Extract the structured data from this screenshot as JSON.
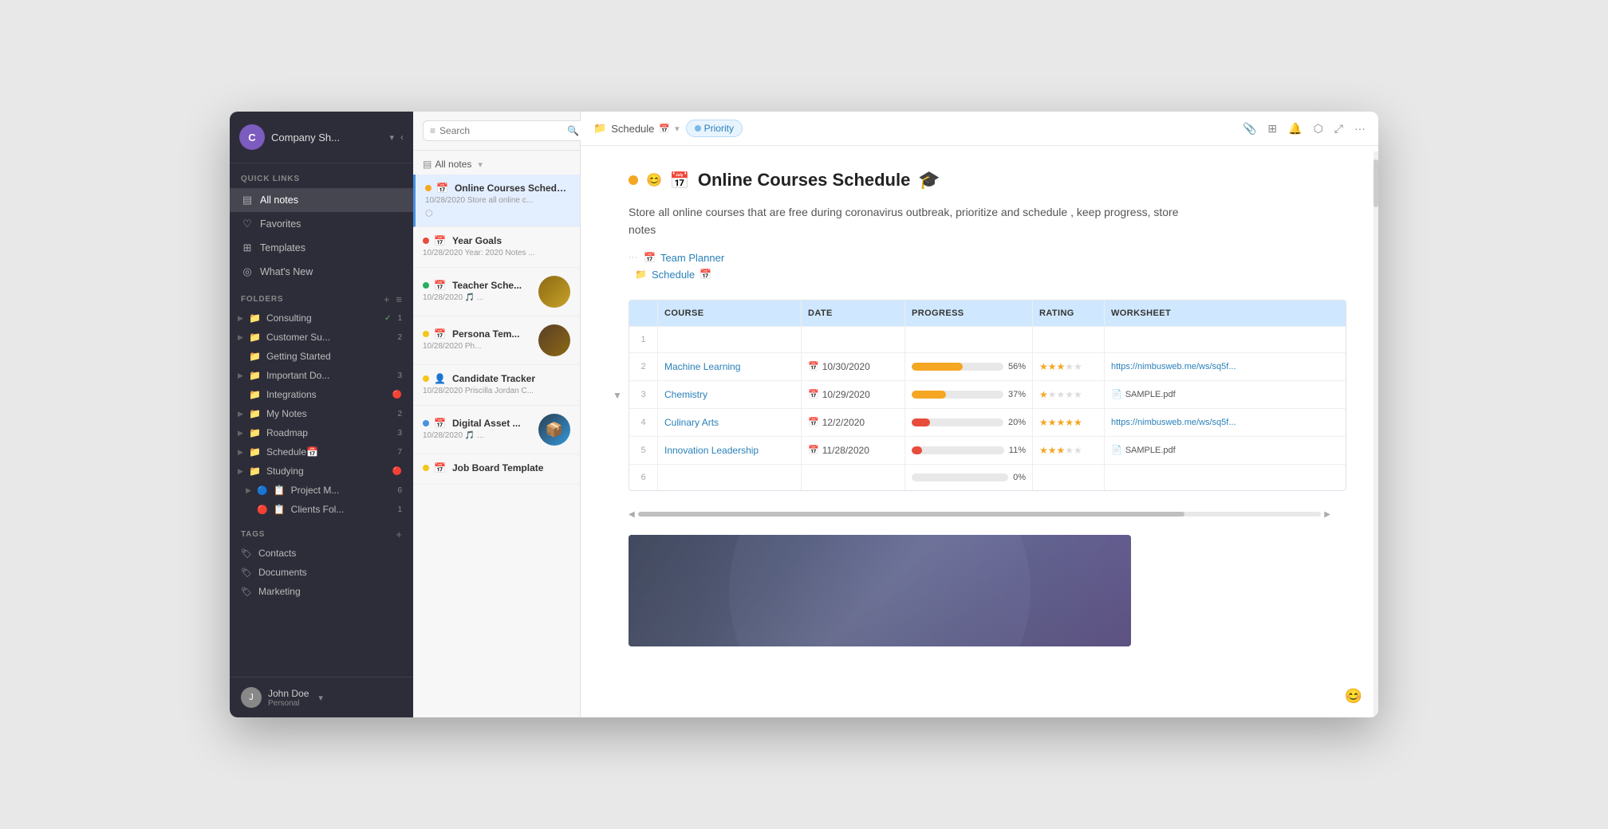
{
  "window": {
    "title": "Company Notes App"
  },
  "sidebar": {
    "company_name": "Company Sh...",
    "avatar_letter": "C",
    "quick_links_label": "Quick Links",
    "items": [
      {
        "id": "all-notes",
        "label": "All notes",
        "icon": "▤",
        "active": true
      },
      {
        "id": "favorites",
        "label": "Favorites",
        "icon": "♡",
        "active": false
      },
      {
        "id": "templates",
        "label": "Templates",
        "icon": "⊞",
        "active": false
      },
      {
        "id": "whats-new",
        "label": "What's New",
        "icon": "◎",
        "active": false
      }
    ],
    "folders_label": "Folders",
    "folders": [
      {
        "name": "Consulting",
        "icon": "📁",
        "has_check": true,
        "badge": "1",
        "expanded": false,
        "indent": 0
      },
      {
        "name": "Customer Su...",
        "icon": "📁",
        "has_check": false,
        "badge": "2",
        "expanded": false,
        "indent": 0
      },
      {
        "name": "Getting Started",
        "icon": "📁",
        "has_check": false,
        "badge": "",
        "expanded": false,
        "indent": 0
      },
      {
        "name": "Important Do...",
        "icon": "📁",
        "has_check": false,
        "badge": "3",
        "expanded": false,
        "indent": 0
      },
      {
        "name": "Integrations",
        "icon": "📁🔴",
        "has_check": false,
        "badge": "",
        "expanded": false,
        "indent": 0
      },
      {
        "name": "My Notes",
        "icon": "📁",
        "has_check": false,
        "badge": "2",
        "expanded": false,
        "indent": 0
      },
      {
        "name": "Roadmap",
        "icon": "📁",
        "has_check": false,
        "badge": "3",
        "expanded": false,
        "indent": 0
      },
      {
        "name": "Schedule",
        "icon": "📁📅",
        "has_check": false,
        "badge": "7",
        "expanded": false,
        "indent": 0
      },
      {
        "name": "Studying",
        "icon": "📁🔴",
        "has_check": false,
        "badge": "",
        "expanded": false,
        "indent": 0
      },
      {
        "name": "Project M...",
        "icon": "🔵📋",
        "has_check": false,
        "badge": "6",
        "expanded": false,
        "indent": 0
      },
      {
        "name": "Clients Fol...",
        "icon": "🔴📋",
        "has_check": false,
        "badge": "1",
        "expanded": false,
        "indent": 0
      }
    ],
    "tags_label": "Tags",
    "tags": [
      {
        "name": "Contacts",
        "icon": "🏷"
      },
      {
        "name": "Documents",
        "icon": "🏷"
      },
      {
        "name": "Marketing",
        "icon": "🏷"
      }
    ],
    "user_name": "John Doe",
    "user_plan": "Personal",
    "user_avatar": "J"
  },
  "notes_panel": {
    "search_placeholder": "Search",
    "all_notes_label": "All notes",
    "notes": [
      {
        "id": 1,
        "title": "Online Courses Schedu...",
        "date": "10/28/2020",
        "preview": "Store all online c...",
        "dot_color": "orange",
        "selected": true,
        "has_avatar": false,
        "has_share": true,
        "icon": "📅"
      },
      {
        "id": 2,
        "title": "Year Goals",
        "date": "10/28/2020",
        "preview": "Year: 2020 Notes ...",
        "dot_color": "red",
        "selected": false,
        "has_avatar": false,
        "icon": "📅"
      },
      {
        "id": 3,
        "title": "Teacher Sche...",
        "date": "10/28/2020",
        "preview": "🎵 ...",
        "dot_color": "green",
        "selected": false,
        "has_avatar": true,
        "avatar_color": "#8B6914",
        "icon": "📅"
      },
      {
        "id": 4,
        "title": "Persona Tem...",
        "date": "10/28/2020",
        "preview": "Ph...",
        "dot_color": "yellow",
        "selected": false,
        "has_avatar": true,
        "avatar_color": "#5a3e28",
        "icon": "📅"
      },
      {
        "id": 5,
        "title": "Candidate Tracker",
        "date": "10/28/2020",
        "preview": "Priscilla Jordan C...",
        "dot_color": "yellow",
        "selected": false,
        "has_avatar": false,
        "icon": "👤"
      },
      {
        "id": 6,
        "title": "Digital Asset ...",
        "date": "10/28/2020",
        "preview": "🎵 ...",
        "dot_color": "blue",
        "selected": false,
        "has_avatar": true,
        "avatar_color": "#2c3e50",
        "icon": "📅"
      },
      {
        "id": 7,
        "title": "Job Board Template",
        "date": "",
        "preview": "",
        "dot_color": "yellow",
        "selected": false,
        "has_avatar": false,
        "icon": "📅"
      }
    ]
  },
  "main": {
    "breadcrumb_icon": "📁",
    "breadcrumb_name": "Schedule",
    "breadcrumb_calendar": "📅",
    "priority_label": "Priority",
    "doc": {
      "title": "Online Courses Schedule",
      "title_emoji": "🎓",
      "description": "Store all online courses that are free during coronavirus outbreak, prioritize and schedule , keep progress, store notes",
      "related_links": [
        {
          "label": "Team Planner",
          "icon": "📅"
        },
        {
          "label": "Schedule",
          "icon": "📁",
          "icon2": "📅"
        }
      ]
    },
    "table": {
      "headers": [
        "",
        "COURSE",
        "DATE",
        "PROGRESS",
        "RATING",
        "WORKSHEET"
      ],
      "rows": [
        {
          "num": "1",
          "is_header_row": true
        },
        {
          "num": "2",
          "course": "Machine Learning",
          "date": "10/30/2020",
          "progress": 56,
          "bar_color": "#f5a623",
          "rating": 3,
          "worksheet": "https://nimbusweb.me/ws/sq5f...",
          "worksheet_type": "link"
        },
        {
          "num": "3",
          "course": "Chemistry",
          "date": "10/29/2020",
          "progress": 37,
          "bar_color": "#f5a623",
          "rating": 1,
          "worksheet": "SAMPLE.pdf",
          "worksheet_type": "pdf"
        },
        {
          "num": "4",
          "course": "Culinary Arts",
          "date": "12/2/2020",
          "progress": 20,
          "bar_color": "#e74c3c",
          "rating": 5,
          "worksheet": "https://nimbusweb.me/ws/sq5f...",
          "worksheet_type": "link"
        },
        {
          "num": "5",
          "course": "Innovation Leadership",
          "date": "11/28/2020",
          "progress": 11,
          "bar_color": "#e74c3c",
          "rating": 3,
          "worksheet": "SAMPLE.pdf",
          "worksheet_type": "pdf"
        },
        {
          "num": "6",
          "course": "",
          "date": "",
          "progress": 0,
          "bar_color": "#e0e0e0",
          "rating": 0,
          "worksheet": "",
          "worksheet_type": ""
        }
      ]
    }
  },
  "toolbar_actions": [
    "📎",
    "⊞",
    "🔔",
    "⬡",
    "⤢",
    "···"
  ]
}
